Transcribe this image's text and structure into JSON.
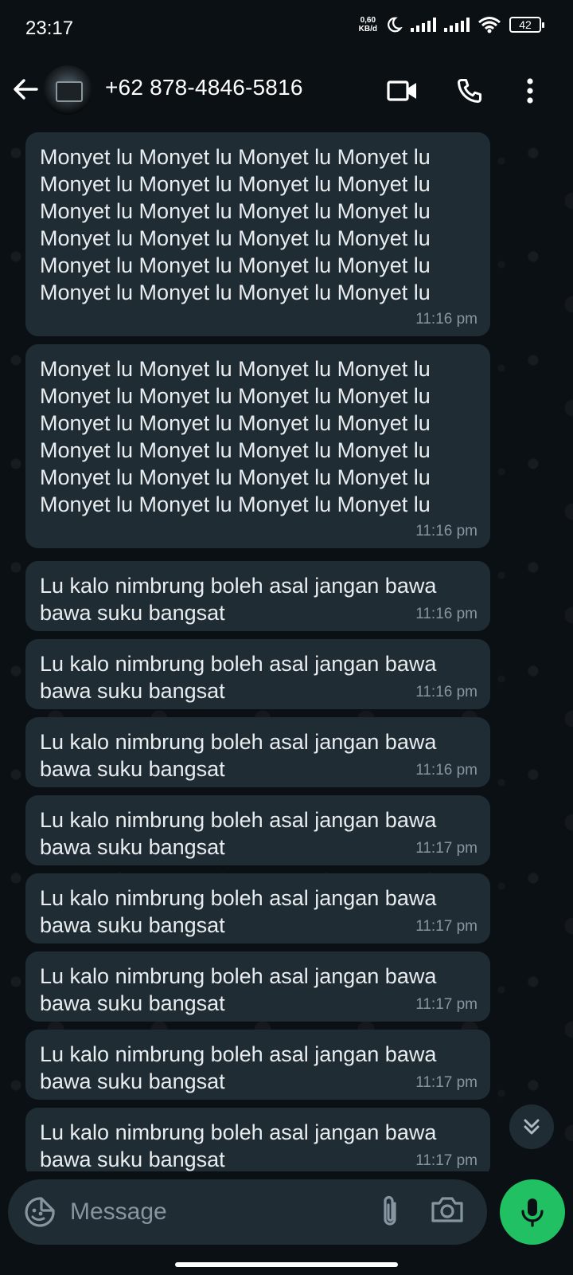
{
  "status_bar": {
    "time": "23:17",
    "net_speed_value": "0,60",
    "net_speed_unit": "KB/d",
    "battery": "42"
  },
  "header": {
    "contact_name": "+62 878-4846-5816",
    "icons": [
      "back-arrow-icon",
      "video-call-icon",
      "phone-call-icon",
      "more-options-icon"
    ]
  },
  "messages": [
    {
      "text": "Monyet lu Monyet lu Monyet lu Monyet lu\nMonyet lu Monyet lu Monyet lu Monyet lu\nMonyet lu Monyet lu Monyet lu Monyet lu\nMonyet lu Monyet lu Monyet lu Monyet lu\nMonyet lu Monyet lu Monyet lu Monyet lu\nMonyet lu Monyet lu Monyet lu Monyet lu",
      "time": "11:16 pm"
    },
    {
      "text": "Monyet lu Monyet lu Monyet lu Monyet lu\nMonyet lu Monyet lu Monyet lu Monyet lu\nMonyet lu Monyet lu Monyet lu Monyet lu\nMonyet lu Monyet lu Monyet lu Monyet lu\nMonyet lu Monyet lu Monyet lu Monyet lu\nMonyet lu Monyet lu Monyet lu Monyet lu",
      "time": "11:16 pm"
    },
    {
      "text": "Lu kalo nimbrung boleh asal jangan bawa\nbawa suku bangsat",
      "time": "11:16 pm"
    },
    {
      "text": "Lu kalo nimbrung boleh asal jangan bawa\nbawa suku bangsat",
      "time": "11:16 pm"
    },
    {
      "text": "Lu kalo nimbrung boleh asal jangan bawa\nbawa suku bangsat",
      "time": "11:16 pm"
    },
    {
      "text": "Lu kalo nimbrung boleh asal jangan bawa\nbawa suku bangsat",
      "time": "11:17 pm"
    },
    {
      "text": "Lu kalo nimbrung boleh asal jangan bawa\nbawa suku bangsat",
      "time": "11:17 pm"
    },
    {
      "text": "Lu kalo nimbrung boleh asal jangan bawa\nbawa suku bangsat",
      "time": "11:17 pm"
    },
    {
      "text": "Lu kalo nimbrung boleh asal jangan bawa\nbawa suku bangsat",
      "time": "11:17 pm"
    },
    {
      "text": "Lu kalo nimbrung boleh asal jangan bawa\nbawa suku bangsat",
      "time": "11:17 pm"
    }
  ],
  "composer": {
    "placeholder": "Message",
    "value": ""
  },
  "colors": {
    "background": "#0b1014",
    "bubble": "#1f2c34",
    "mic_button": "#21c063",
    "timestamp": "#8696a0"
  }
}
